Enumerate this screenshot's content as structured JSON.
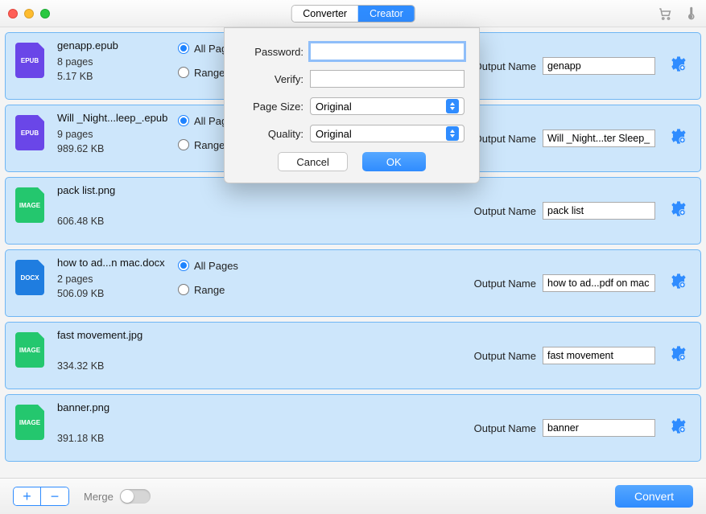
{
  "titlebar": {
    "tabs": {
      "converter": "Converter",
      "creator": "Creator",
      "active": "creator"
    }
  },
  "rows": [
    {
      "icon": "EPUB",
      "iconClass": "epub",
      "filename": "genapp.epub",
      "pages": "8 pages",
      "size": "5.17 KB",
      "hasPages": true,
      "allPages": "All Pages",
      "range": "Range",
      "outputNameLabel": "Output Name",
      "outputName": "genapp"
    },
    {
      "icon": "EPUB",
      "iconClass": "epub",
      "filename": "Will _Night...leep_.epub",
      "pages": "9 pages",
      "size": "989.62 KB",
      "hasPages": true,
      "allPages": "All Pages",
      "range": "Range",
      "outputNameLabel": "Output Name",
      "outputName": "Will _Night...ter Sleep_"
    },
    {
      "icon": "IMAGE",
      "iconClass": "image",
      "filename": "pack list.png",
      "pages": "",
      "size": "606.48 KB",
      "hasPages": false,
      "outputNameLabel": "Output Name",
      "outputName": "pack list"
    },
    {
      "icon": "DOCX",
      "iconClass": "docx",
      "filename": "how to ad...n mac.docx",
      "pages": "2 pages",
      "size": "506.09 KB",
      "hasPages": true,
      "allPages": "All Pages",
      "range": "Range",
      "outputNameLabel": "Output Name",
      "outputName": "how to ad...pdf on mac"
    },
    {
      "icon": "IMAGE",
      "iconClass": "image",
      "filename": "fast movement.jpg",
      "pages": "",
      "size": "334.32 KB",
      "hasPages": false,
      "outputNameLabel": "Output Name",
      "outputName": "fast movement"
    },
    {
      "icon": "IMAGE",
      "iconClass": "image",
      "filename": "banner.png",
      "pages": "",
      "size": "391.18 KB",
      "hasPages": false,
      "outputNameLabel": "Output Name",
      "outputName": "banner"
    }
  ],
  "bottom": {
    "merge": "Merge",
    "convert": "Convert"
  },
  "modal": {
    "password_label": "Password:",
    "verify_label": "Verify:",
    "pagesize_label": "Page Size:",
    "pagesize_value": "Original",
    "quality_label": "Quality:",
    "quality_value": "Original",
    "cancel": "Cancel",
    "ok": "OK"
  }
}
